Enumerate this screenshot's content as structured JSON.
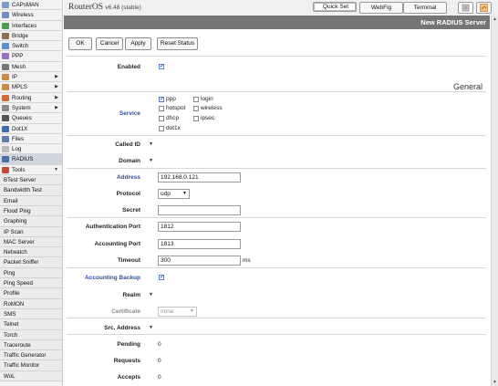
{
  "sidebar": {
    "items": [
      {
        "label": "CAPsMAN",
        "icon": "capsman-icon",
        "color": "#7d9ccc"
      },
      {
        "label": "Wireless",
        "icon": "wireless-icon",
        "color": "#6f8fc2"
      },
      {
        "label": "Interfaces",
        "icon": "interfaces-icon",
        "color": "#4f9c4f"
      },
      {
        "label": "Bridge",
        "icon": "bridge-icon",
        "color": "#8c6f4c"
      },
      {
        "label": "Switch",
        "icon": "switch-icon",
        "color": "#5a8fd1"
      },
      {
        "label": "PPP",
        "icon": "ppp-icon",
        "color": "#9a6ec4"
      },
      {
        "label": "Mesh",
        "icon": "mesh-icon",
        "color": "#777777"
      },
      {
        "label": "IP",
        "icon": "ip-icon",
        "color": "#c98a4a",
        "arrow": "▶"
      },
      {
        "label": "MPLS",
        "icon": "mpls-icon",
        "color": "#c98a4a",
        "arrow": "▶"
      },
      {
        "label": "Routing",
        "icon": "routing-icon",
        "color": "#d46a3c",
        "arrow": "▶"
      },
      {
        "label": "System",
        "icon": "system-icon",
        "color": "#8a8a8a",
        "arrow": "▶"
      },
      {
        "label": "Queues",
        "icon": "queues-icon",
        "color": "#555555"
      },
      {
        "label": "Dot1X",
        "icon": "dot1x-icon",
        "color": "#3c6cb4"
      },
      {
        "label": "Files",
        "icon": "files-icon",
        "color": "#5c7fae"
      },
      {
        "label": "Log",
        "icon": "log-icon",
        "color": "#bbbbbb"
      },
      {
        "label": "RADIUS",
        "icon": "radius-icon",
        "color": "#4a6fa8",
        "active": true
      },
      {
        "label": "Tools",
        "icon": "tools-icon",
        "color": "#c44a3c",
        "arrow": "▼"
      }
    ],
    "tools": [
      "BTest Server",
      "Bandwidth Test",
      "Email",
      "Flood Ping",
      "Graphing",
      "IP Scan",
      "MAC Server",
      "Netwatch",
      "Packet Sniffer",
      "Ping",
      "Ping Speed",
      "Profile",
      "RoMON",
      "SMS",
      "Telnet",
      "Torch",
      "Traceroute",
      "Traffic Generator",
      "Traffic Monitor",
      "WoL"
    ]
  },
  "topbar": {
    "brand": "RouterOS",
    "version": "v6.48 (stable)",
    "tabs": [
      "Quick Set",
      "WebFig",
      "Terminal"
    ],
    "selected_tab": "Quick Set"
  },
  "window": {
    "title": "New RADIUS Server"
  },
  "buttons": {
    "ok": "OK",
    "cancel": "Cancel",
    "apply": "Apply",
    "reset": "Reset Status"
  },
  "form": {
    "enabled_label": "Enabled",
    "section": "General",
    "service_label": "Service",
    "services": [
      {
        "name": "ppp",
        "checked": true
      },
      {
        "name": "login",
        "checked": false
      },
      {
        "name": "hotspot",
        "checked": false
      },
      {
        "name": "wireless",
        "checked": false
      },
      {
        "name": "dhcp",
        "checked": false
      },
      {
        "name": "ipsec",
        "checked": false
      },
      {
        "name": "dot1x",
        "checked": false
      }
    ],
    "called_id_label": "Called ID",
    "domain_label": "Domain",
    "address_label": "Address",
    "address_value": "192.168.0.121",
    "protocol_label": "Protocol",
    "protocol_value": "udp",
    "secret_label": "Secret",
    "secret_value": "",
    "auth_port_label": "Authentication Port",
    "auth_port_value": "1812",
    "acct_port_label": "Accounting Port",
    "acct_port_value": "1813",
    "timeout_label": "Timeout",
    "timeout_value": "300",
    "timeout_unit": "ms",
    "accounting_backup_label": "Accounting Backup",
    "realm_label": "Realm",
    "certificate_label": "Certificate",
    "certificate_value": "none",
    "src_address_label": "Src. Address",
    "pending_label": "Pending",
    "pending_value": "0",
    "requests_label": "Requests",
    "requests_value": "0",
    "accepts_label": "Accepts",
    "accepts_value": "0"
  }
}
